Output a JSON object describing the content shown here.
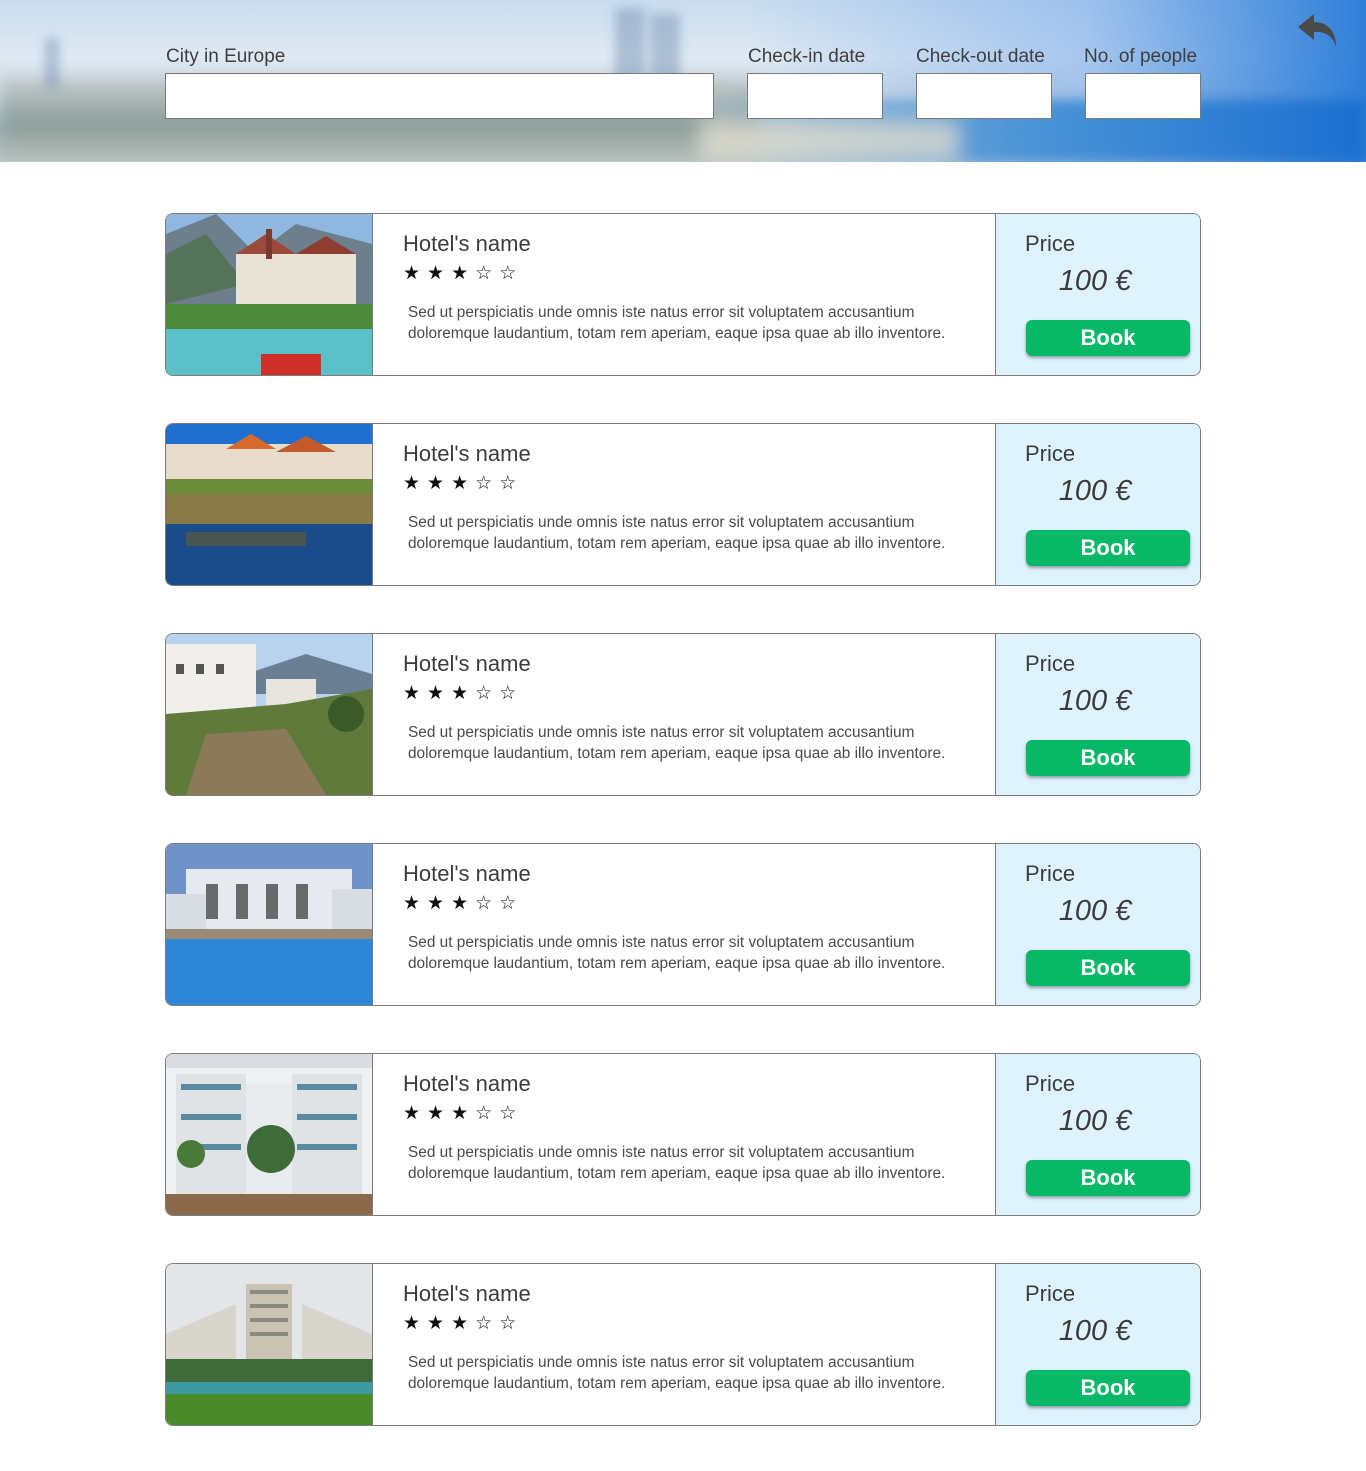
{
  "search": {
    "city_label": "City in Europe",
    "city_value": "",
    "checkin_label": "Check-in date",
    "checkin_value": "",
    "checkout_label": "Check-out date",
    "checkout_value": "",
    "people_label": "No. of people",
    "people_value": ""
  },
  "header": {
    "back_icon": "undo-arrow-icon"
  },
  "hotels": [
    {
      "name": "Hotel's name",
      "rating": 3,
      "max_rating": 5,
      "description": "Sed ut perspiciatis unde omnis iste natus error sit voluptatem accusantium doloremque laudantium, totam rem aperiam, eaque ipsa quae ab illo inventore.",
      "price_label": "Price",
      "price": "100 €",
      "book_label": "Book",
      "photo": "lakeside-town-photo"
    },
    {
      "name": "Hotel's name",
      "rating": 3,
      "max_rating": 5,
      "description": "Sed ut perspiciatis unde omnis iste natus error sit voluptatem accusantium doloremque laudantium, totam rem aperiam, eaque ipsa quae ab illo inventore.",
      "price_label": "Price",
      "price": "100 €",
      "book_label": "Book",
      "photo": "riverside-houses-photo"
    },
    {
      "name": "Hotel's name",
      "rating": 3,
      "max_rating": 5,
      "description": "Sed ut perspiciatis unde omnis iste natus error sit voluptatem accusantium doloremque laudantium, totam rem aperiam, eaque ipsa quae ab illo inventore.",
      "price_label": "Price",
      "price": "100 €",
      "book_label": "Book",
      "photo": "cliffside-village-photo"
    },
    {
      "name": "Hotel's name",
      "rating": 3,
      "max_rating": 5,
      "description": "Sed ut perspiciatis unde omnis iste natus error sit voluptatem accusantium doloremque laudantium, totam rem aperiam, eaque ipsa quae ab illo inventore.",
      "price_label": "Price",
      "price": "100 €",
      "book_label": "Book",
      "photo": "hotel-pool-photo"
    },
    {
      "name": "Hotel's name",
      "rating": 3,
      "max_rating": 5,
      "description": "Sed ut perspiciatis unde omnis iste natus error sit voluptatem accusantium doloremque laudantium, totam rem aperiam, eaque ipsa quae ab illo inventore.",
      "price_label": "Price",
      "price": "100 €",
      "book_label": "Book",
      "photo": "hotel-courtyard-photo"
    },
    {
      "name": "Hotel's name",
      "rating": 3,
      "max_rating": 5,
      "description": "Sed ut perspiciatis unde omnis iste natus error sit voluptatem accusantium doloremque laudantium, totam rem aperiam, eaque ipsa quae ab illo inventore.",
      "price_label": "Price",
      "price": "100 €",
      "book_label": "Book",
      "photo": "resort-tower-photo"
    }
  ],
  "colors": {
    "book_button": "#07b966",
    "price_panel": "#dff3ff"
  }
}
